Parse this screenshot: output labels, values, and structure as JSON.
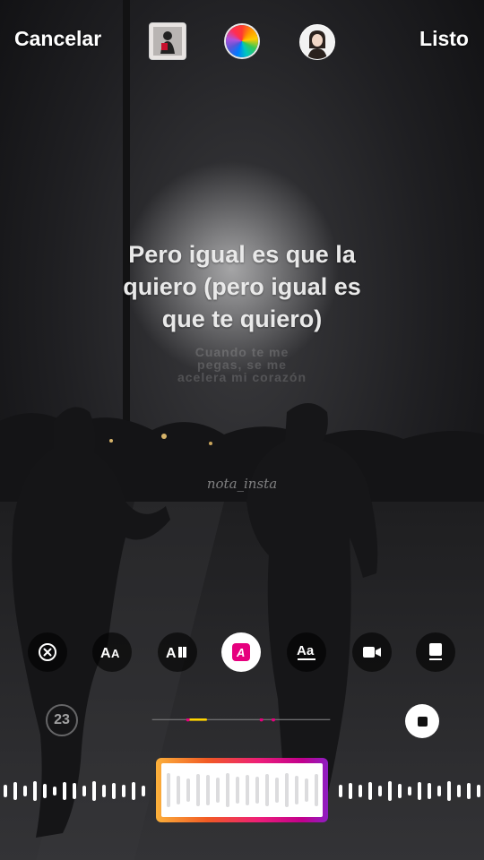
{
  "topbar": {
    "cancel_label": "Cancelar",
    "done_label": "Listo"
  },
  "lyrics": {
    "current_lines": [
      "Pero igual es que la",
      "quiero (pero igual es",
      "que te quiero)"
    ],
    "next_lines": [
      "Cuando te me",
      "pegas, se me",
      "acelera mi corazón"
    ]
  },
  "watermark": "nota_insta",
  "timeline": {
    "duration": "23"
  },
  "colors": {
    "accent_pink": "#e6007e",
    "progress_yellow": "#ffd400",
    "selector_gradient": [
      "#fbb03b",
      "#f15a24",
      "#ed1e79",
      "#c1008d",
      "#8e1ec3"
    ]
  },
  "icons": {
    "style_buttons": [
      "remove-lyrics-icon",
      "typewriter-text-icon",
      "highlight-text-icon",
      "pink-text-style-icon",
      "underline-text-icon",
      "video-style-icon",
      "portrait-style-icon"
    ]
  }
}
